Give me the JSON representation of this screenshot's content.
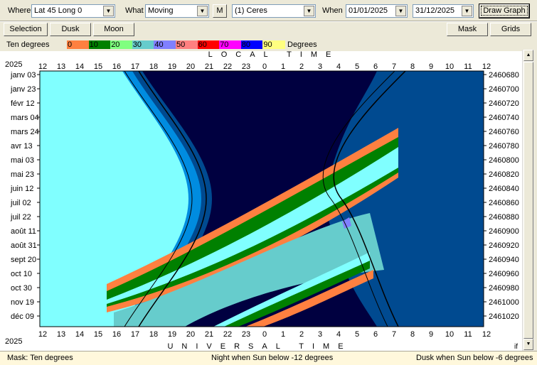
{
  "toolbar": {
    "where_label": "Where",
    "where_value": "Lat 45 Long 0",
    "what_label": "What",
    "what_value": "Moving",
    "m_button": "M",
    "object_value": "(1) Ceres",
    "when_label": "When",
    "date_from": "01/01/2025",
    "date_to": "31/12/2025",
    "draw_button": "Draw Graph"
  },
  "buttons": {
    "selection": "Selection",
    "dusk": "Dusk",
    "moon": "Moon",
    "mask": "Mask",
    "grids": "Grids"
  },
  "legend": {
    "left_label": "Ten degrees",
    "right_label": "Degrees",
    "ticks": [
      "0",
      "10",
      "20",
      "30",
      "40",
      "50",
      "60",
      "70",
      "80",
      "90"
    ],
    "colors": [
      "#FF8040",
      "#008000",
      "#80FF80",
      "#66CCCC",
      "#8080FF",
      "#FF8080",
      "#FF0000",
      "#FF00FF",
      "#0000FF",
      "#FFFF80"
    ]
  },
  "chart_data": {
    "type": "heatmap",
    "title": "LOCAL TIME",
    "bottom_title": "UNIVERSAL TIME",
    "year_top": "2025",
    "year_bottom": "2025",
    "hour_ticks": [
      "12",
      "13",
      "14",
      "15",
      "16",
      "17",
      "18",
      "19",
      "20",
      "21",
      "22",
      "23",
      "0",
      "1",
      "2",
      "3",
      "4",
      "5",
      "6",
      "7",
      "8",
      "9",
      "10",
      "11",
      "12"
    ],
    "date_labels": [
      "janv 03",
      "janv 23",
      "févr 12",
      "mars 04",
      "mars 24",
      "avr 13",
      "mai 03",
      "mai 23",
      "juin 12",
      "juil 02",
      "juil 22",
      "août 11",
      "août 31",
      "sept 20",
      "oct 10",
      "oct 30",
      "nov 19",
      "déc 09"
    ],
    "jd_labels": [
      "2460680",
      "2460700",
      "2460720",
      "2460740",
      "2460760",
      "2460780",
      "2460800",
      "2460820",
      "2460840",
      "2460860",
      "2460880",
      "2460900",
      "2460920",
      "2460940",
      "2460960",
      "2460980",
      "2461000",
      "2461020"
    ],
    "colors": {
      "day": "#80FFFF",
      "civil_twilight": "#008CE0",
      "nautical_twilight": "#004A90",
      "night": "#000040"
    }
  },
  "status": {
    "mask": "Mask:  Ten degrees",
    "night": "Night when Sun below -12 degrees",
    "dusk": "Dusk when Sun below -6 degrees",
    "corner": "if"
  }
}
